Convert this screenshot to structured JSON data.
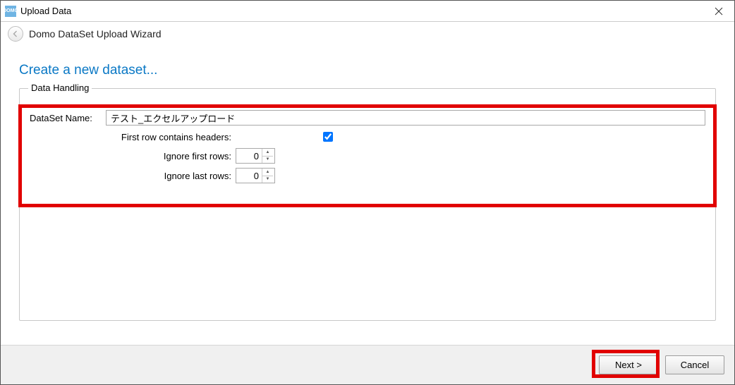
{
  "window": {
    "title": "Upload Data",
    "app_icon_text": "DOMO"
  },
  "wizard": {
    "header": "Domo DataSet Upload Wizard",
    "heading": "Create a new dataset..."
  },
  "group": {
    "legend": "Data Handling",
    "dataset_name_label": "DataSet Name:",
    "dataset_name_value": "テスト_エクセルアップロード",
    "headers_label": "First row contains headers:",
    "headers_checked": true,
    "ignore_first_label": "Ignore first rows:",
    "ignore_first_value": "0",
    "ignore_last_label": "Ignore last rows:",
    "ignore_last_value": "0"
  },
  "footer": {
    "next_label": "Next >",
    "cancel_label": "Cancel"
  }
}
